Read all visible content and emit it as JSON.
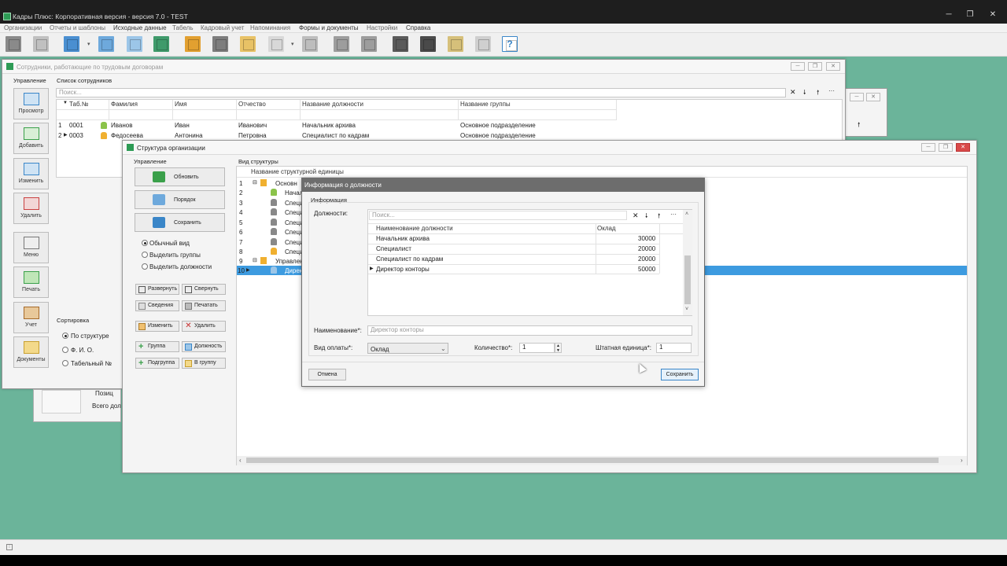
{
  "app": {
    "title": "Кадры Плюс: Корпоративная версия - версия 7.0 - TEST",
    "window_controls": [
      "─",
      "❐",
      "✕"
    ]
  },
  "menu": [
    "Организации",
    "Отчеты и шаблоны",
    "Исходные данные",
    "Табель",
    "Кадровый учет",
    "Напоминания",
    "Формы и документы",
    "Настройки",
    "Справка"
  ],
  "toolbar": {
    "icons": [
      "new-document-icon",
      "edit-document-icon",
      "table-view-icon",
      "tree-structure-icon",
      "cards-icon",
      "exit-icon",
      "chart-icon",
      "archive-icon",
      "folder-icon",
      "checklist-icon",
      "register-icon",
      "calendar-icon",
      "grid-icon",
      "tools-icon",
      "monitor-icon",
      "report-icon",
      "print-icon",
      "help-icon"
    ],
    "help_label": "?"
  },
  "employees_window": {
    "title": "Сотрудники, работающие по трудовым договорам",
    "panel_label": "Управление",
    "list_label": "Список сотрудников",
    "search_placeholder": "Поиск...",
    "buttons": [
      "Просмотр",
      "Добавить",
      "Изменить",
      "Удалить",
      "Меню",
      "Печать",
      "Учет",
      "Документы"
    ],
    "columns": [
      "Таб.№",
      "Фамилия",
      "Имя",
      "Отчество",
      "Название должности",
      "Название группы"
    ],
    "rows": [
      {
        "n": "1",
        "tab": "0001",
        "last": "Иванов",
        "first": "Иван",
        "middle": "Иванович",
        "position": "Начальник архива",
        "group": "Основное подразделение"
      },
      {
        "n": "2",
        "tab": "0003",
        "last": "Федосеева",
        "first": "Антонина",
        "middle": "Петровна",
        "position": "Специалист по кадрам",
        "group": "Основное подразделение"
      }
    ],
    "sort_label": "Сортировка",
    "sort_options": [
      "По структуре",
      "Ф. И. О.",
      "Табельный №"
    ],
    "partial_labels": [
      "Позиц",
      "Всего дол"
    ]
  },
  "structure_window": {
    "title": "Структура организации",
    "panel_label": "Управление",
    "buttons": [
      "Обновить",
      "Порядок",
      "Сохранить"
    ],
    "view_options": [
      "Обычный вид",
      "Выделить группы",
      "Выделить должности"
    ],
    "small_buttons": [
      "Развернуть",
      "Свернуть",
      "Сведения",
      "Печатать",
      "Изменить",
      "Удалить",
      "Группа",
      "Должность",
      "Подгруппа",
      "В группу"
    ],
    "tree_label": "Вид структуры",
    "tree_header": "Название структурной единицы",
    "tree_rows": [
      {
        "n": "1",
        "text": "Основн"
      },
      {
        "n": "2",
        "text": "Начал"
      },
      {
        "n": "3",
        "text": "Специ"
      },
      {
        "n": "4",
        "text": "Специ"
      },
      {
        "n": "5",
        "text": "Специ"
      },
      {
        "n": "6",
        "text": "Специ"
      },
      {
        "n": "7",
        "text": "Специ"
      },
      {
        "n": "8",
        "text": "Специ"
      },
      {
        "n": "9",
        "text": "Управлен"
      },
      {
        "n": "10",
        "text": "Дирек"
      }
    ]
  },
  "position_dialog": {
    "title": "Информация о должности",
    "group_label": "Информация",
    "positions_label": "Должности:",
    "search_placeholder": "Поиск...",
    "columns": [
      "Наименование должности",
      "Оклад"
    ],
    "rows": [
      {
        "name": "Начальник архива",
        "salary": "30000"
      },
      {
        "name": "Специалист",
        "salary": "20000"
      },
      {
        "name": "Специалист по кадрам",
        "salary": "20000"
      },
      {
        "name": "Директор конторы",
        "salary": "50000"
      }
    ],
    "name_label": "Наименование*:",
    "name_value": "Директор конторы",
    "pay_label": "Вид оплаты*:",
    "pay_value": "Оклад",
    "qty_label": "Количество*:",
    "qty_value": "1",
    "unit_label": "Штатная единица*:",
    "unit_value": "1",
    "cancel": "Отмена",
    "save": "Сохранить"
  },
  "colors": {
    "accent": "#3a9ad9",
    "selection": "#3d9be0",
    "dialog_title": "#6d6d6d",
    "desktop": "#6bb49a"
  }
}
